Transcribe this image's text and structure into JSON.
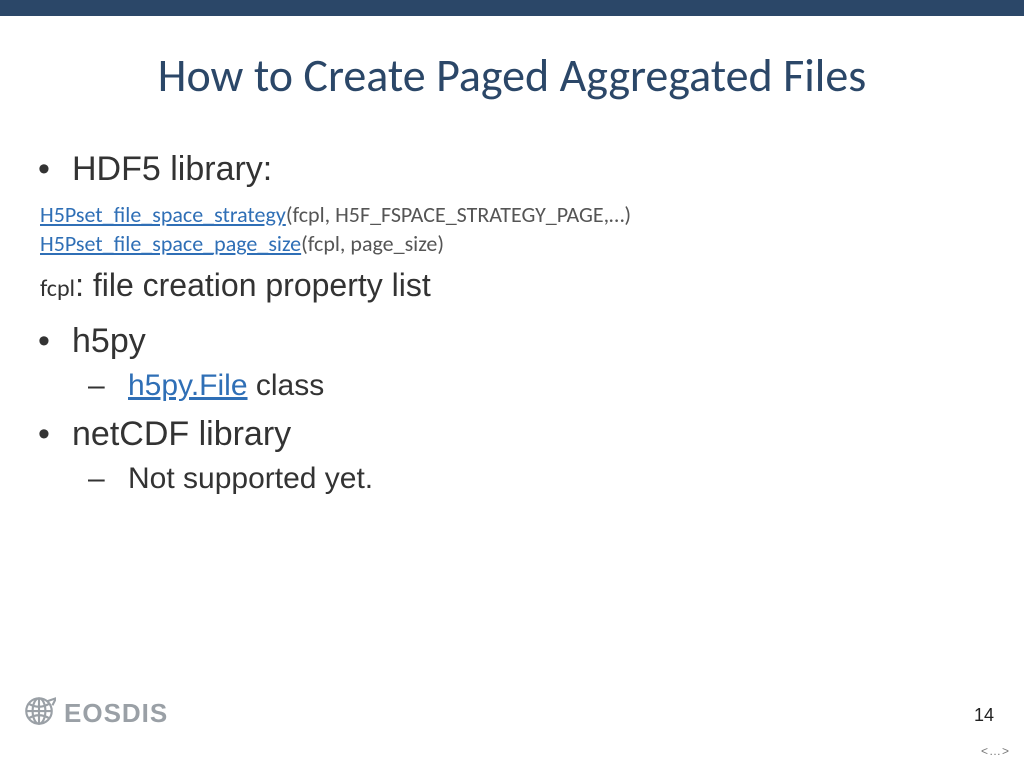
{
  "title": "How to Create Paged Aggregated Files",
  "bullets": {
    "hdf5": {
      "label": "HDF5 library:",
      "code1_link": "H5Pset_file_space_strategy",
      "code1_rest": "(fcpl, H5F_FSPACE_STRATEGY_PAGE,…)",
      "code2_link": "H5Pset_file_space_page_size",
      "code2_rest": "(fcpl, page_size)",
      "def_term": "fcpl",
      "def_rest": ": file creation property list"
    },
    "h5py": {
      "label": "h5py",
      "sub_link": "h5py.File",
      "sub_rest": " class"
    },
    "netcdf": {
      "label": "netCDF library",
      "sub_text": "Not supported yet."
    }
  },
  "footer": {
    "brand": "EOSDIS",
    "page_number": "14",
    "hint": "<…>"
  }
}
